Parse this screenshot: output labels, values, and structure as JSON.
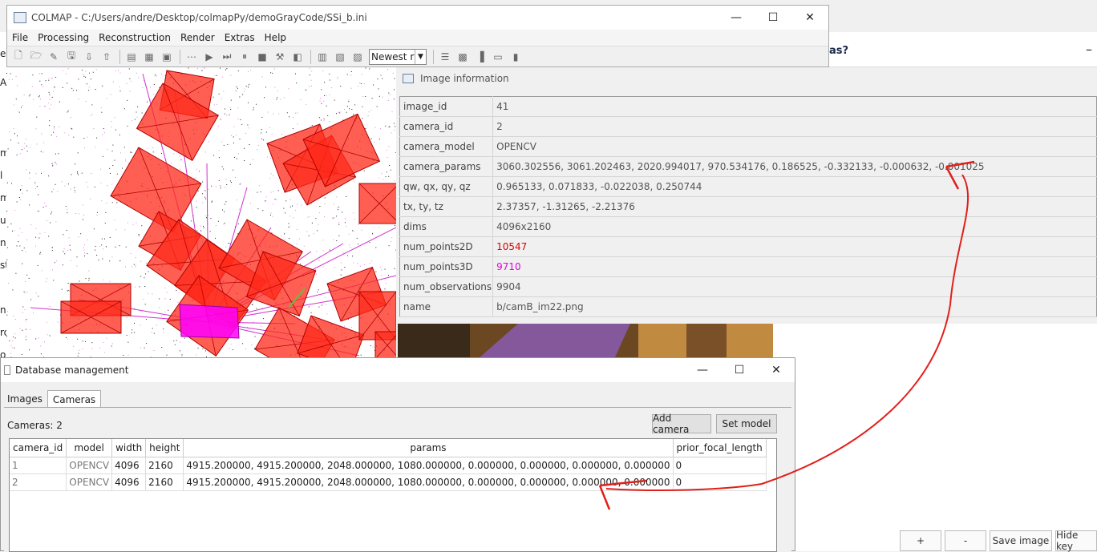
{
  "colmap": {
    "title": "COLMAP - C:/Users/andre/Desktop/colmapPy/demoGrayCode/SSi_b.ini",
    "menu": [
      "File",
      "Processing",
      "Reconstruction",
      "Render",
      "Extras",
      "Help"
    ],
    "combo_value": "Newest r"
  },
  "background": {
    "header_fragment": "as?",
    "minimize": "–",
    "left_fragments": [
      "e",
      "A",
      "m",
      "l",
      "m",
      "u",
      "n",
      "st",
      "n",
      "ro",
      "o"
    ]
  },
  "image_info": {
    "title": "Image information",
    "rows": [
      {
        "key": "image_id",
        "value": "41",
        "color": ""
      },
      {
        "key": "camera_id",
        "value": "2",
        "color": ""
      },
      {
        "key": "camera_model",
        "value": "OPENCV",
        "color": ""
      },
      {
        "key": "camera_params",
        "value": "3060.302556, 3061.202463, 2020.994017, 970.534176, 0.186525, -0.332133, -0.000632, -0.001025",
        "color": ""
      },
      {
        "key": "qw, qx, qy, qz",
        "value": "0.965133, 0.071833, -0.022038, 0.250744",
        "color": ""
      },
      {
        "key": "tx, ty, tz",
        "value": "2.37357, -1.31265, -2.21376",
        "color": ""
      },
      {
        "key": "dims",
        "value": "4096x2160",
        "color": ""
      },
      {
        "key": "num_points2D",
        "value": "10547",
        "color": "#e00000"
      },
      {
        "key": "num_points3D",
        "value": "9710",
        "color": "#e000e0"
      },
      {
        "key": "num_observations",
        "value": "9904",
        "color": ""
      },
      {
        "key": "name",
        "value": "b/camB_im22.png",
        "color": ""
      }
    ],
    "buttons": [
      "+",
      "-",
      "Save image",
      "Hide key"
    ]
  },
  "db": {
    "title": "Database management",
    "tabs": [
      "Images",
      "Cameras"
    ],
    "camera_count": "Cameras: 2",
    "add_camera": "Add camera",
    "set_model": "Set model",
    "columns": [
      "camera_id",
      "model",
      "width",
      "height",
      "params",
      "prior_focal_length"
    ],
    "rows": [
      [
        "1",
        "OPENCV",
        "4096",
        "2160",
        "4915.200000, 4915.200000, 2048.000000, 1080.000000, 0.000000, 0.000000, 0.000000, 0.000000",
        "0"
      ],
      [
        "2",
        "OPENCV",
        "4096",
        "2160",
        "4915.200000, 4915.200000, 2048.000000, 1080.000000, 0.000000, 0.000000, 0.000000, 0.000000",
        "0"
      ]
    ]
  },
  "colors": {
    "camera_frustum": "#ff2a1a",
    "selected_camera": "#ff00ff",
    "annotation_arrow": "#e0201a"
  }
}
